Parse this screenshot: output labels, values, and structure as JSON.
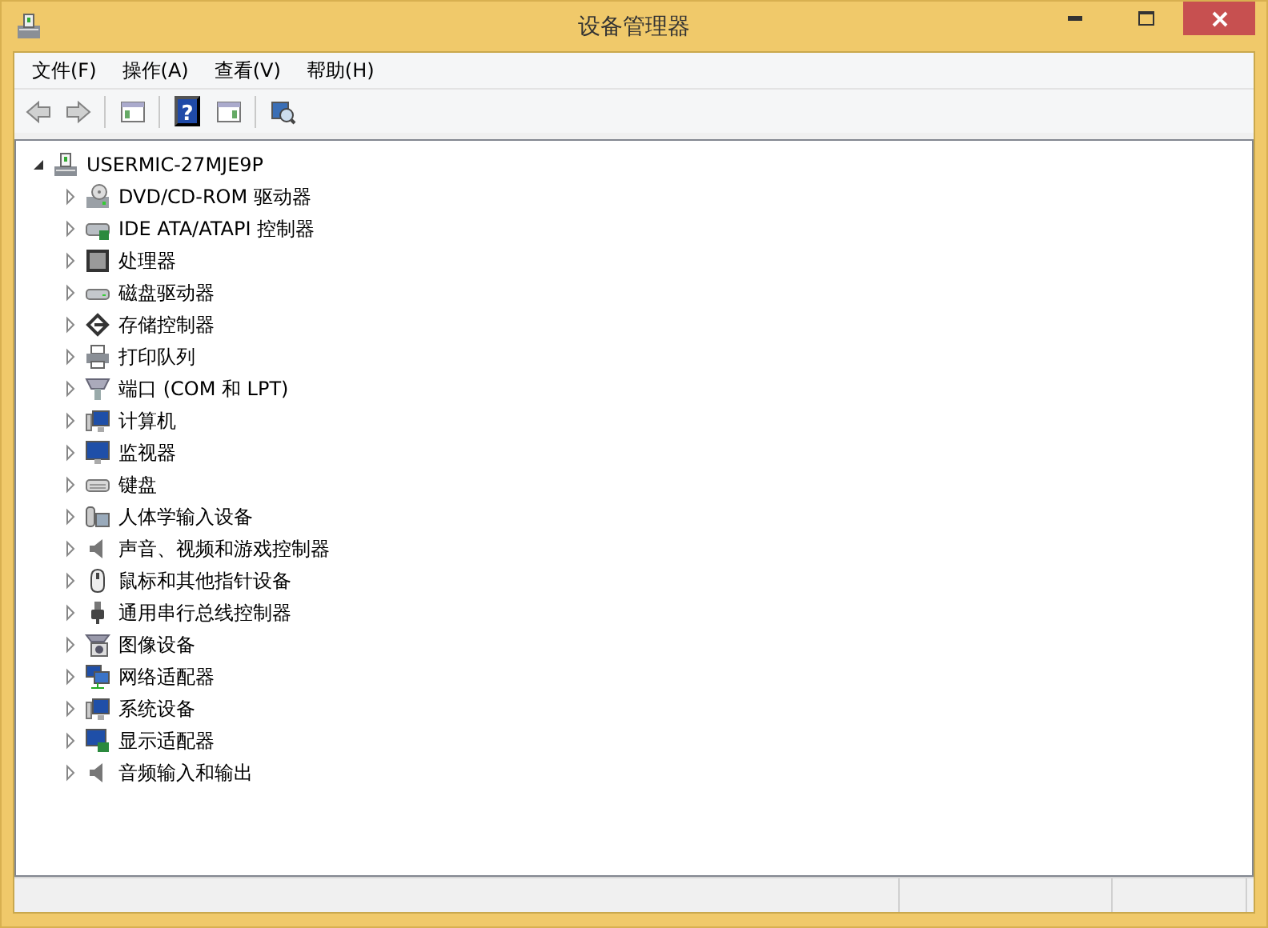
{
  "window": {
    "title": "设备管理器"
  },
  "menu": [
    "文件(F)",
    "操作(A)",
    "查看(V)",
    "帮助(H)"
  ],
  "toolbar": [
    {
      "kind": "back",
      "disabled": true
    },
    {
      "kind": "forward",
      "disabled": true
    },
    {
      "kind": "separator"
    },
    {
      "kind": "console-tree",
      "disabled": false
    },
    {
      "kind": "separator"
    },
    {
      "kind": "help",
      "disabled": false,
      "glyph": "?"
    },
    {
      "kind": "action-pane",
      "disabled": false
    },
    {
      "kind": "separator"
    },
    {
      "kind": "scan",
      "disabled": false
    }
  ],
  "tree": {
    "label": "USERMIC-27MJE9P",
    "kind": "host",
    "expanded": true,
    "children": [
      {
        "label": "DVD/CD-ROM 驱动器",
        "kind": "dvd",
        "expanded": false
      },
      {
        "label": "IDE ATA/ATAPI 控制器",
        "kind": "ide",
        "expanded": false
      },
      {
        "label": "处理器",
        "kind": "cpu",
        "expanded": false
      },
      {
        "label": "磁盘驱动器",
        "kind": "disk",
        "expanded": false
      },
      {
        "label": "存储控制器",
        "kind": "storage",
        "expanded": false
      },
      {
        "label": "打印队列",
        "kind": "printer",
        "expanded": false
      },
      {
        "label": "端口 (COM 和 LPT)",
        "kind": "port",
        "expanded": false
      },
      {
        "label": "计算机",
        "kind": "computer",
        "expanded": false
      },
      {
        "label": "监视器",
        "kind": "monitor",
        "expanded": false
      },
      {
        "label": "键盘",
        "kind": "keyboard",
        "expanded": false
      },
      {
        "label": "人体学输入设备",
        "kind": "hid",
        "expanded": false
      },
      {
        "label": "声音、视频和游戏控制器",
        "kind": "speaker",
        "expanded": false
      },
      {
        "label": "鼠标和其他指针设备",
        "kind": "mouse",
        "expanded": false
      },
      {
        "label": "通用串行总线控制器",
        "kind": "usb",
        "expanded": false
      },
      {
        "label": "图像设备",
        "kind": "camera",
        "expanded": false
      },
      {
        "label": "网络适配器",
        "kind": "network",
        "expanded": false
      },
      {
        "label": "系统设备",
        "kind": "computer",
        "expanded": false
      },
      {
        "label": "显示适配器",
        "kind": "display",
        "expanded": false
      },
      {
        "label": "音频输入和输出",
        "kind": "speaker",
        "expanded": false
      }
    ]
  }
}
